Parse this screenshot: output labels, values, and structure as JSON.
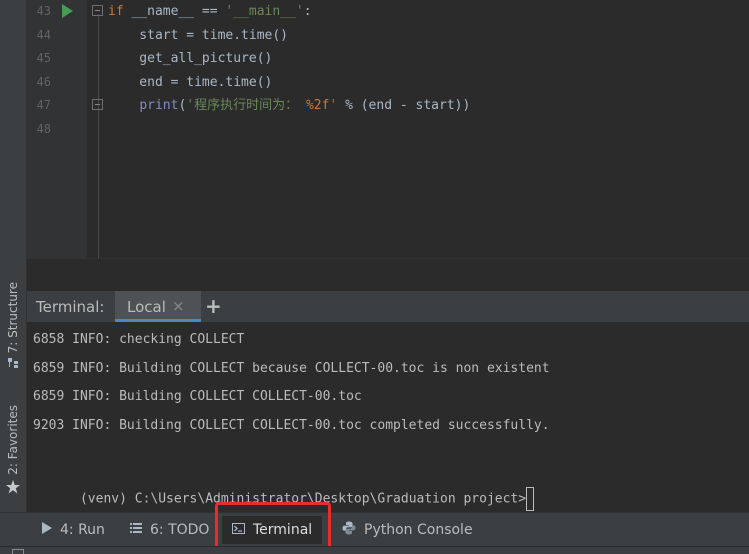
{
  "left_strip": {
    "structure_label": "7: Structure",
    "structure_icon": "structure-icon",
    "favorites_label": "2: Favorites",
    "favorites_icon": "star-icon"
  },
  "editor": {
    "lines": [
      {
        "number": "43",
        "parts": [
          [
            "kw",
            "if"
          ],
          [
            "plain",
            " __name__ == "
          ],
          [
            "str",
            "'__main__'"
          ],
          [
            "plain",
            ":"
          ]
        ]
      },
      {
        "number": "44",
        "parts": [
          [
            "plain",
            "    start = time.time()"
          ]
        ]
      },
      {
        "number": "45",
        "parts": [
          [
            "plain",
            "    get_all_picture()"
          ]
        ]
      },
      {
        "number": "46",
        "parts": [
          [
            "plain",
            "    end = time.time()"
          ]
        ]
      },
      {
        "number": "47",
        "parts": [
          [
            "plain",
            "    "
          ],
          [
            "fn",
            "print"
          ],
          [
            "plain",
            "("
          ],
          [
            "str",
            "'程序执行时间为： "
          ],
          [
            "fmt",
            "%2f"
          ],
          [
            "str",
            "'"
          ],
          [
            "plain",
            " % (end - start))"
          ]
        ]
      },
      {
        "number": "48",
        "parts": []
      }
    ],
    "colors": {
      "keyword": "#cc7832",
      "string": "#6a8759",
      "builtin": "#8888c6",
      "text": "#a9b7c6"
    }
  },
  "terminal": {
    "title": "Terminal:",
    "tab_label": "Local",
    "close_glyph": "×",
    "add_glyph": "+",
    "lines": [
      "6858 INFO: checking COLLECT",
      "6859 INFO: Building COLLECT because COLLECT-00.toc is non existent",
      "6859 INFO: Building COLLECT COLLECT-00.toc",
      "9203 INFO: Building COLLECT COLLECT-00.toc completed successfully."
    ],
    "prompt": "(venv) C:\\Users\\Administrator\\Desktop\\Graduation project>"
  },
  "toolbar": {
    "run_label": "4: Run",
    "todo_label": "6: TODO",
    "terminal_label": "Terminal",
    "python_console_label": "Python Console",
    "highlight_color": "#e62e2e"
  }
}
